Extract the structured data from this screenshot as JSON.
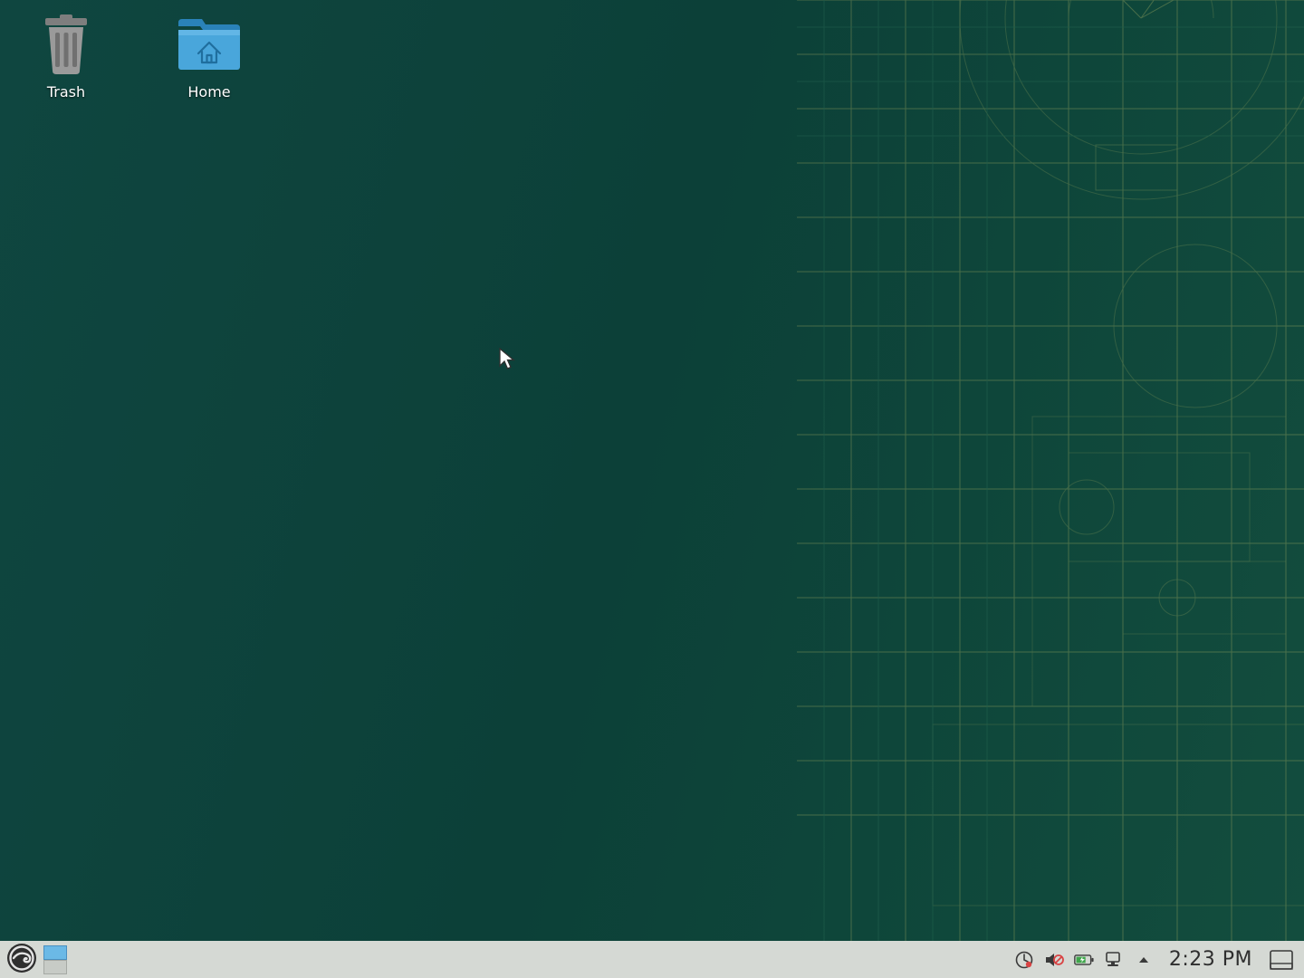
{
  "desktop": {
    "icons": [
      {
        "id": "trash",
        "label": "Trash"
      },
      {
        "id": "home",
        "label": "Home"
      }
    ]
  },
  "taskbar": {
    "workspaces": {
      "count": 2,
      "active": 1
    },
    "tray_icons": [
      "updates-icon",
      "volume-muted-icon",
      "battery-charging-icon",
      "network-icon",
      "notifications-arrow-icon"
    ],
    "clock": "2:23 PM"
  },
  "colors": {
    "desktop_bg": "#0f4640",
    "panel_bg": "#d5d9d4",
    "folder_blue": "#49a6db",
    "text_light": "#ffffff"
  }
}
